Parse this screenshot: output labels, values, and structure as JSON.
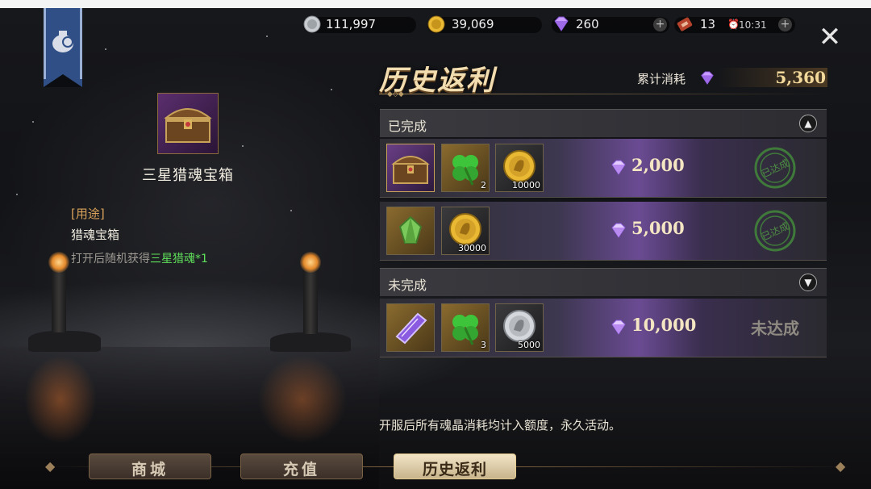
{
  "resources": {
    "silver": {
      "icon": "silver-coin-icon",
      "value": "111,997"
    },
    "gold": {
      "icon": "gold-coin-icon",
      "value": "39,069"
    },
    "gem": {
      "icon": "diamond-icon",
      "value": "260"
    },
    "ticket": {
      "icon": "ticket-icon",
      "value": "13",
      "timer": "10:31"
    }
  },
  "close_icon": "close-icon",
  "item": {
    "name": "三星猎魂宝箱",
    "icon": "treasure-chest-icon",
    "use_tag": "[用途]",
    "use_title": "猎魂宝箱",
    "use_desc_prefix": "打开后随机获得",
    "use_desc_highlight": "三星猎魂*1"
  },
  "panel": {
    "title": "历史返利",
    "cumulative_label": "累计消耗",
    "cumulative_value": "5,360"
  },
  "sections": {
    "completed": {
      "label": "已完成",
      "toggle_icon": "chevron-up-icon"
    },
    "incomplete": {
      "label": "未完成",
      "toggle_icon": "chevron-down-icon"
    }
  },
  "rows": [
    {
      "requirement": "2,000",
      "status": "stamp",
      "stamp_text": "已达成",
      "items": [
        {
          "icon": "treasure-chest-icon",
          "count": "",
          "rarity": "purple"
        },
        {
          "icon": "four-leaf-clover-icon",
          "count": "2",
          "rarity": "gold"
        },
        {
          "icon": "gold-coin-icon",
          "count": "10000",
          "rarity": "gray"
        }
      ]
    },
    {
      "requirement": "5,000",
      "status": "stamp",
      "stamp_text": "已达成",
      "items": [
        {
          "icon": "green-gem-icon",
          "count": "",
          "rarity": "gold"
        },
        {
          "icon": "gold-coin-icon",
          "count": "30000",
          "rarity": "gray"
        }
      ]
    },
    {
      "requirement": "10,000",
      "status": "text",
      "status_text": "未达成",
      "items": [
        {
          "icon": "purple-scroll-icon",
          "count": "",
          "rarity": "gold"
        },
        {
          "icon": "four-leaf-clover-icon",
          "count": "3",
          "rarity": "gold"
        },
        {
          "icon": "silver-coin-icon",
          "count": "5000",
          "rarity": "gray"
        }
      ]
    }
  ],
  "note": "开服后所有魂晶消耗均计入额度，永久活动。",
  "tabs": [
    {
      "label": "商城",
      "active": false
    },
    {
      "label": "充值",
      "active": false
    },
    {
      "label": "历史返利",
      "active": true
    }
  ]
}
